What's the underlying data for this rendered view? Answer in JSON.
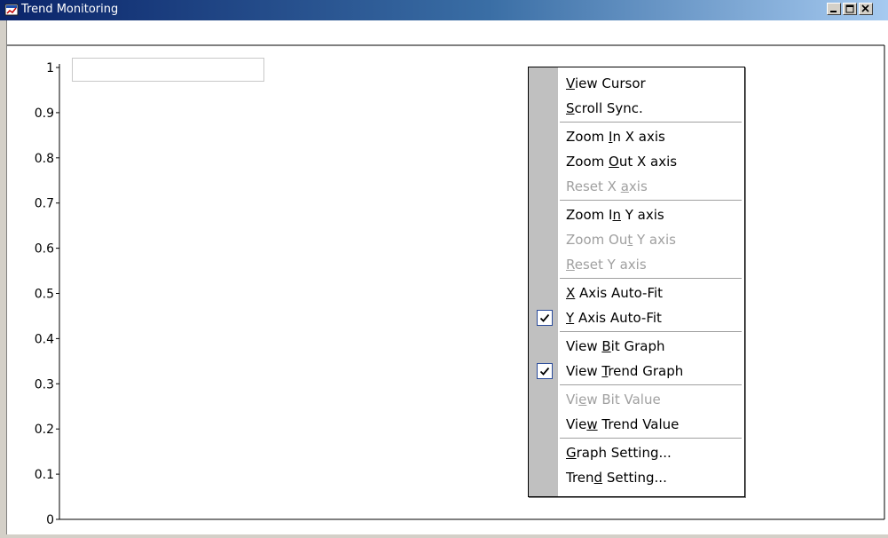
{
  "window": {
    "title": "Trend Monitoring",
    "controls": [
      "minimize",
      "maximize",
      "close"
    ]
  },
  "chart_data": {
    "type": "line",
    "ylim": [
      0,
      1
    ],
    "y_ticks": [
      "1",
      "0.9",
      "0.8",
      "0.7",
      "0.6",
      "0.5",
      "0.4",
      "0.3",
      "0.2",
      "0.1",
      "0"
    ],
    "series": [],
    "legend": "top-left"
  },
  "context_menu": {
    "groups": [
      [
        {
          "label": "View Cursor",
          "mnemonic": "V",
          "enabled": true,
          "checked": false
        },
        {
          "label": "Scroll Sync.",
          "mnemonic": "S",
          "enabled": true,
          "checked": false
        }
      ],
      [
        {
          "label": "Zoom In X axis",
          "mnemonic": "I",
          "enabled": true,
          "checked": false
        },
        {
          "label": "Zoom Out X axis",
          "mnemonic": "O",
          "enabled": true,
          "checked": false
        },
        {
          "label": "Reset X axis",
          "mnemonic": "a",
          "enabled": false,
          "checked": false
        }
      ],
      [
        {
          "label": "Zoom In Y axis",
          "mnemonic": "n",
          "enabled": true,
          "checked": false
        },
        {
          "label": "Zoom Out Y axis",
          "mnemonic": "t",
          "enabled": false,
          "checked": false
        },
        {
          "label": "Reset Y axis",
          "mnemonic": "R",
          "enabled": false,
          "checked": false
        }
      ],
      [
        {
          "label": "X Axis Auto-Fit",
          "mnemonic": "X",
          "enabled": true,
          "checked": false
        },
        {
          "label": "Y Axis Auto-Fit",
          "mnemonic": "Y",
          "enabled": true,
          "checked": true
        }
      ],
      [
        {
          "label": "View Bit Graph",
          "mnemonic": "B",
          "enabled": true,
          "checked": false
        },
        {
          "label": "View Trend Graph",
          "mnemonic": "T",
          "enabled": true,
          "checked": true
        }
      ],
      [
        {
          "label": "View Bit Value",
          "mnemonic": "e",
          "enabled": false,
          "checked": false
        },
        {
          "label": "View Trend Value",
          "mnemonic": "w",
          "enabled": true,
          "checked": false
        }
      ],
      [
        {
          "label": "Graph Setting...",
          "mnemonic": "G",
          "enabled": true,
          "checked": false
        },
        {
          "label": "Trend Setting...",
          "mnemonic": "d",
          "enabled": true,
          "checked": false
        }
      ]
    ]
  },
  "colors": {
    "titlebar_start": "#0a246a",
    "titlebar_end": "#a6caf0",
    "menu_gutter": "#c0c0c0",
    "disabled_text": "#a0a0a0",
    "check_border": "#2a4b9b"
  }
}
